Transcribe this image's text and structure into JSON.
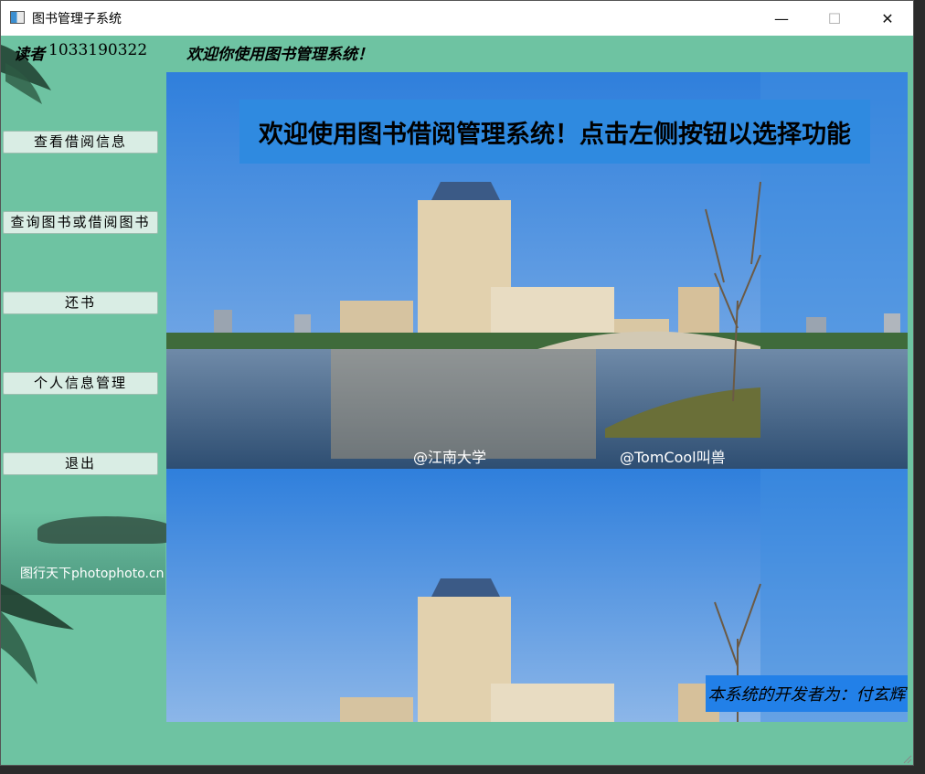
{
  "window": {
    "title": "图书管理子系统",
    "icon": "app-window-icon",
    "controls": {
      "minimize": "—",
      "maximize": "☐",
      "close": "✕"
    }
  },
  "header": {
    "author_label": "读者",
    "author_id": "1033190322",
    "welcome": "欢迎你使用图书管理系统！"
  },
  "sidebar": {
    "buttons": [
      {
        "label": "查看借阅信息"
      },
      {
        "label": "查询图书或借阅图书"
      },
      {
        "label": "还书"
      },
      {
        "label": "个人信息管理"
      },
      {
        "label": "退出"
      }
    ],
    "watermark": "图行天下photophoto.cn"
  },
  "main": {
    "welcome_banner": "欢迎使用图书借阅管理系统！点击左侧按钮以选择功能",
    "weibo_tags": [
      "@江南大学",
      "@TomCool叫兽"
    ],
    "developer_note": "本系统的开发者为：付玄辉"
  },
  "colors": {
    "background": "#6ec3a2",
    "banner": "#2f8ae0",
    "dev_banner": "#2280e8",
    "button_bg": "#d9ede4"
  }
}
